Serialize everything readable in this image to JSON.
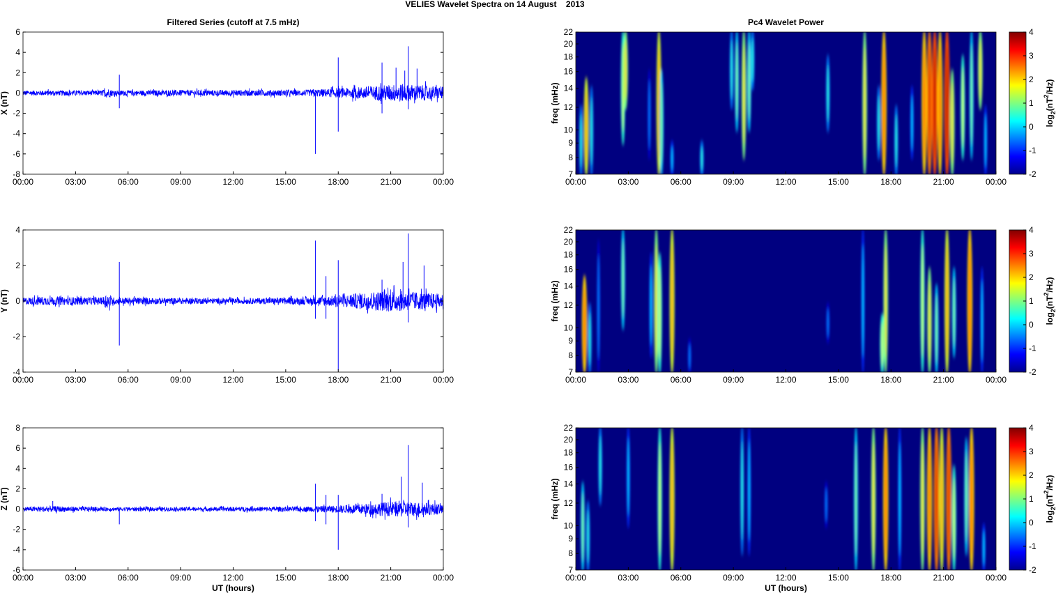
{
  "title": "VELIES Wavelet Spectra on 14 August    2013",
  "chart_data": [
    {
      "type": "line",
      "title": "Filtered Series (cutoff at 7.5 mHz)",
      "ylabel": "X (nT)",
      "xlabel": "",
      "xlim": [
        0,
        24
      ],
      "ylim": [
        -8,
        6
      ],
      "yticks": [
        -8,
        -6,
        -4,
        -2,
        0,
        2,
        4,
        6
      ],
      "xtick_labels": [
        "00:00",
        "03:00",
        "06:00",
        "09:00",
        "12:00",
        "15:00",
        "18:00",
        "21:00",
        "00:00"
      ],
      "color": "#0000ff",
      "noise_envelope": [
        [
          0,
          0.25
        ],
        [
          4.5,
          0.25
        ],
        [
          4.8,
          0.5
        ],
        [
          5.2,
          0.25
        ],
        [
          10,
          0.3
        ],
        [
          16,
          0.3
        ],
        [
          18.5,
          0.5
        ],
        [
          20,
          0.7
        ],
        [
          21.5,
          0.9
        ],
        [
          22.5,
          0.8
        ],
        [
          24,
          0.6
        ]
      ],
      "spikes": [
        [
          5.5,
          1.8
        ],
        [
          5.5,
          -1.5
        ],
        [
          16.7,
          -6
        ],
        [
          18.0,
          3.5
        ],
        [
          18.0,
          -3.8
        ],
        [
          20.5,
          3.0
        ],
        [
          20.5,
          -2.0
        ],
        [
          21.3,
          2.5
        ],
        [
          21.8,
          2.2
        ],
        [
          22.0,
          4.6
        ],
        [
          22.0,
          -1.6
        ],
        [
          22.5,
          2.4
        ]
      ]
    },
    {
      "type": "heatmap",
      "title": "Pc4 Wavelet Power",
      "ylabel": "freq (mHz)",
      "xlabel": "",
      "xlim": [
        0,
        24
      ],
      "ylim": [
        7,
        22
      ],
      "yscale": "log",
      "yticks": [
        7,
        8,
        9,
        10,
        12,
        14,
        16,
        18,
        20,
        22
      ],
      "xtick_labels": [
        "00:00",
        "03:00",
        "06:00",
        "09:00",
        "12:00",
        "15:00",
        "18:00",
        "21:00",
        "00:00"
      ],
      "colorbar": {
        "range": [
          -2,
          4
        ],
        "ticks": [
          -2,
          -1,
          0,
          1,
          2,
          3,
          4
        ],
        "label_parts": [
          "log",
          "2",
          "(nT",
          "2",
          "/Hz)"
        ]
      },
      "bursts": [
        [
          0.3,
          7,
          12,
          0.5
        ],
        [
          0.6,
          7,
          15,
          2.5
        ],
        [
          0.9,
          7,
          14,
          0.5
        ],
        [
          2.7,
          9,
          22,
          1.5
        ],
        [
          2.85,
          12,
          22,
          2
        ],
        [
          4.2,
          8,
          16,
          -0.5
        ],
        [
          4.75,
          7,
          22,
          2.5
        ],
        [
          4.9,
          7,
          16,
          1
        ],
        [
          5.5,
          7,
          9,
          0
        ],
        [
          7.2,
          7,
          9,
          0.5
        ],
        [
          8.9,
          12,
          22,
          0.5
        ],
        [
          9.2,
          10,
          22,
          1
        ],
        [
          9.6,
          8,
          22,
          2
        ],
        [
          9.9,
          10,
          22,
          1
        ],
        [
          10.1,
          14,
          22,
          0.5
        ],
        [
          14.4,
          10,
          18,
          0.5
        ],
        [
          16.5,
          7,
          22,
          2
        ],
        [
          17.3,
          8,
          14,
          0.5
        ],
        [
          17.6,
          7,
          22,
          3
        ],
        [
          18.3,
          7,
          12,
          0.5
        ],
        [
          19.2,
          8,
          14,
          0
        ],
        [
          19.9,
          7,
          22,
          3
        ],
        [
          20.2,
          7,
          22,
          3.5
        ],
        [
          20.5,
          7,
          22,
          3.8
        ],
        [
          20.8,
          7,
          22,
          3
        ],
        [
          21.2,
          7,
          22,
          3.8
        ],
        [
          21.5,
          7,
          16,
          2
        ],
        [
          22.1,
          8,
          18,
          1.5
        ],
        [
          22.6,
          8,
          22,
          1
        ],
        [
          23.1,
          12,
          22,
          2
        ],
        [
          23.4,
          7,
          12,
          0
        ]
      ]
    },
    {
      "type": "line",
      "title": "",
      "ylabel": "Y (nT)",
      "xlabel": "",
      "xlim": [
        0,
        24
      ],
      "ylim": [
        -4,
        4
      ],
      "yticks": [
        -4,
        -2,
        0,
        2,
        4
      ],
      "xtick_labels": [
        "00:00",
        "03:00",
        "06:00",
        "09:00",
        "12:00",
        "15:00",
        "18:00",
        "21:00",
        "00:00"
      ],
      "color": "#0000ff",
      "noise_envelope": [
        [
          0,
          0.2
        ],
        [
          1,
          0.25
        ],
        [
          4.5,
          0.2
        ],
        [
          4.8,
          0.45
        ],
        [
          5.2,
          0.2
        ],
        [
          12,
          0.15
        ],
        [
          16,
          0.2
        ],
        [
          18.5,
          0.35
        ],
        [
          19.5,
          0.5
        ],
        [
          21,
          0.6
        ],
        [
          22,
          0.55
        ],
        [
          24,
          0.4
        ]
      ],
      "spikes": [
        [
          5.5,
          2.2
        ],
        [
          5.5,
          -2.5
        ],
        [
          16.7,
          3.4
        ],
        [
          16.7,
          -1.0
        ],
        [
          17.3,
          1.4
        ],
        [
          17.3,
          -1.0
        ],
        [
          18.0,
          2.3
        ],
        [
          18.0,
          -3.9
        ],
        [
          20.5,
          1.2
        ],
        [
          21.7,
          2.2
        ],
        [
          22.0,
          3.8
        ],
        [
          22.0,
          -1.2
        ],
        [
          22.9,
          2.0
        ]
      ]
    },
    {
      "type": "heatmap",
      "title": "",
      "ylabel": "freq (mHz)",
      "xlabel": "",
      "xlim": [
        0,
        24
      ],
      "ylim": [
        7,
        22
      ],
      "yscale": "log",
      "yticks": [
        7,
        8,
        9,
        10,
        12,
        14,
        16,
        18,
        20,
        22
      ],
      "xtick_labels": [
        "00:00",
        "03:00",
        "06:00",
        "09:00",
        "12:00",
        "15:00",
        "18:00",
        "21:00",
        "00:00"
      ],
      "colorbar": {
        "range": [
          -2,
          4
        ],
        "ticks": [
          -2,
          -1,
          0,
          1,
          2,
          3,
          4
        ],
        "label_parts": [
          "log",
          "2",
          "(nT",
          "2",
          "/Hz)"
        ]
      },
      "bursts": [
        [
          0.5,
          7,
          15,
          3
        ],
        [
          0.8,
          7,
          12,
          0.5
        ],
        [
          1.3,
          7,
          20,
          -0.5
        ],
        [
          2.7,
          10,
          22,
          1
        ],
        [
          4.3,
          8,
          18,
          0
        ],
        [
          4.6,
          7,
          22,
          2
        ],
        [
          4.8,
          7,
          18,
          1.5
        ],
        [
          5.5,
          7,
          22,
          2.5
        ],
        [
          6.5,
          7,
          9,
          -0.5
        ],
        [
          14.4,
          9,
          12,
          -0.5
        ],
        [
          16.4,
          7,
          22,
          0
        ],
        [
          17.5,
          7,
          11,
          1.5
        ],
        [
          17.7,
          7,
          22,
          2
        ],
        [
          19.8,
          7,
          22,
          1.5
        ],
        [
          20.2,
          7,
          16,
          2
        ],
        [
          20.6,
          7,
          14,
          1
        ],
        [
          21.2,
          7,
          22,
          2.5
        ],
        [
          21.6,
          8,
          16,
          1
        ],
        [
          22.5,
          7,
          22,
          3
        ],
        [
          23.2,
          7,
          16,
          0
        ]
      ]
    },
    {
      "type": "line",
      "title": "",
      "ylabel": "Z (nT)",
      "xlabel": "UT (hours)",
      "xlim": [
        0,
        24
      ],
      "ylim": [
        -6,
        8
      ],
      "yticks": [
        -6,
        -4,
        -2,
        0,
        2,
        4,
        6,
        8
      ],
      "xtick_labels": [
        "00:00",
        "03:00",
        "06:00",
        "09:00",
        "12:00",
        "15:00",
        "18:00",
        "21:00",
        "00:00"
      ],
      "color": "#0000ff",
      "noise_envelope": [
        [
          0,
          0.2
        ],
        [
          1.5,
          0.3
        ],
        [
          4.5,
          0.2
        ],
        [
          10,
          0.2
        ],
        [
          16,
          0.25
        ],
        [
          18.5,
          0.4
        ],
        [
          20,
          0.6
        ],
        [
          21.5,
          0.8
        ],
        [
          22.5,
          0.7
        ],
        [
          24,
          0.5
        ]
      ],
      "spikes": [
        [
          1.7,
          0.8
        ],
        [
          5.5,
          -1.5
        ],
        [
          16.7,
          2.5
        ],
        [
          16.7,
          -1.2
        ],
        [
          17.3,
          1.4
        ],
        [
          17.3,
          -1.5
        ],
        [
          18.0,
          1.4
        ],
        [
          18.0,
          -4.0
        ],
        [
          20.5,
          1.5
        ],
        [
          21.6,
          3.2
        ],
        [
          22.0,
          6.3
        ],
        [
          22.0,
          -1.8
        ],
        [
          22.8,
          2.6
        ]
      ]
    },
    {
      "type": "heatmap",
      "title": "",
      "ylabel": "freq (mHz)",
      "xlabel": "UT (hours)",
      "xlim": [
        0,
        24
      ],
      "ylim": [
        7,
        22
      ],
      "yscale": "log",
      "yticks": [
        7,
        8,
        9,
        10,
        12,
        14,
        16,
        18,
        20,
        22
      ],
      "xtick_labels": [
        "00:00",
        "03:00",
        "06:00",
        "09:00",
        "12:00",
        "15:00",
        "18:00",
        "21:00",
        "00:00"
      ],
      "colorbar": {
        "range": [
          -2,
          4
        ],
        "ticks": [
          -2,
          -1,
          0,
          1,
          2,
          3,
          4
        ],
        "label_parts": [
          "log",
          "2",
          "(nT",
          "2",
          "/Hz)"
        ]
      },
      "bursts": [
        [
          0.4,
          7,
          14,
          1
        ],
        [
          0.7,
          7,
          12,
          0.5
        ],
        [
          1.4,
          12,
          22,
          0.5
        ],
        [
          3.0,
          10,
          22,
          0
        ],
        [
          4.8,
          7,
          22,
          1.5
        ],
        [
          5.5,
          7,
          22,
          2.5
        ],
        [
          9.5,
          8,
          22,
          0.5
        ],
        [
          9.9,
          8,
          22,
          0
        ],
        [
          14.3,
          10,
          14,
          -0.5
        ],
        [
          16.0,
          7,
          22,
          1
        ],
        [
          17.0,
          7,
          22,
          2
        ],
        [
          17.7,
          7,
          22,
          3
        ],
        [
          18.5,
          7,
          22,
          0
        ],
        [
          19.8,
          7,
          22,
          2
        ],
        [
          20.2,
          7,
          22,
          3
        ],
        [
          20.6,
          7,
          22,
          3.5
        ],
        [
          20.9,
          7,
          22,
          2.5
        ],
        [
          21.3,
          7,
          22,
          3.5
        ],
        [
          21.6,
          7,
          16,
          1.5
        ],
        [
          22.3,
          8,
          20,
          1
        ],
        [
          22.6,
          7,
          22,
          3
        ],
        [
          23.3,
          7,
          10,
          0
        ]
      ]
    }
  ]
}
